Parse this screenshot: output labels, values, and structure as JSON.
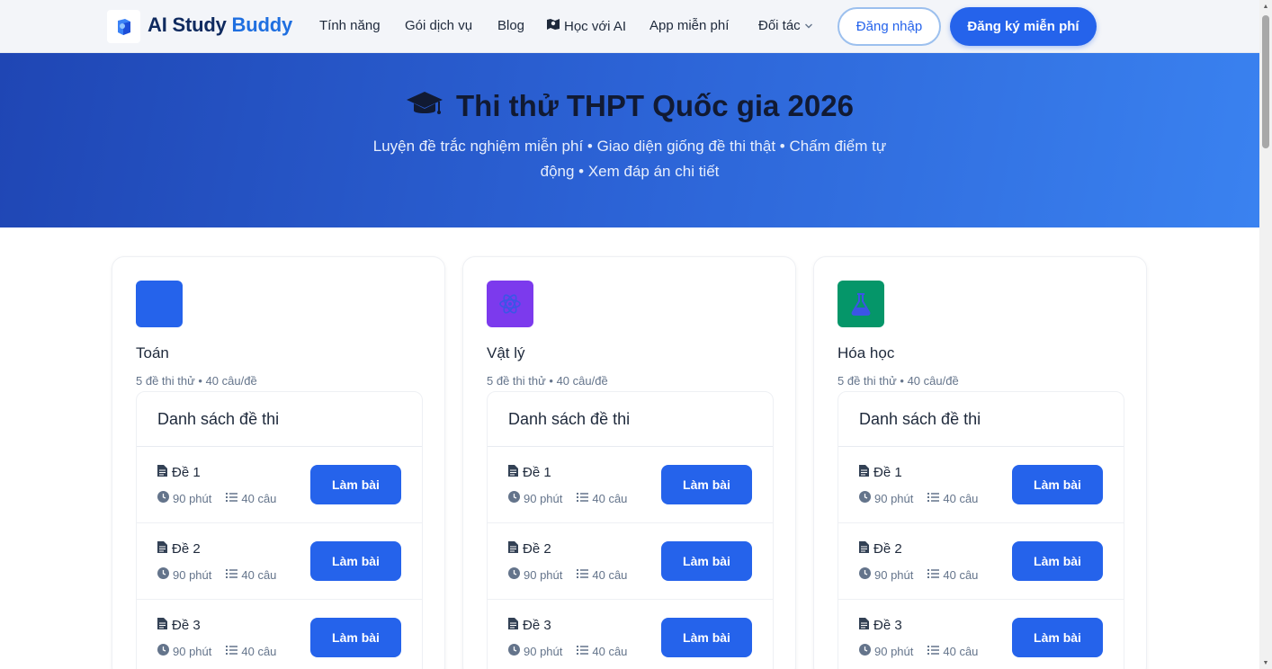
{
  "nav": {
    "logo": {
      "part1": "AI Study",
      "part2": "Buddy"
    },
    "links": [
      {
        "label": "Tính năng"
      },
      {
        "label": "Gói dịch vụ"
      },
      {
        "label": "Blog"
      },
      {
        "label": "Học với AI",
        "icon": "map-icon"
      },
      {
        "label": "App miễn phí"
      },
      {
        "label": "Đối tác",
        "icon": "chevron-down-icon"
      }
    ],
    "login_label": "Đăng nhập",
    "signup_label": "Đăng ký miễn phí"
  },
  "hero": {
    "icon": "graduation-cap-icon",
    "title": "Thi thử THPT Quốc gia 2026",
    "subtitle": "Luyện đề trắc nghiệm miễn phí • Giao diện giống đề thi thật • Chấm điểm tự động • Xem đáp án chi tiết"
  },
  "subjects": [
    {
      "name": "Toán",
      "meta": "5 đề thi thử • 40 câu/đề",
      "icon_color": "#2563eb",
      "list_title": "Danh sách đề thi",
      "exams": [
        {
          "title": "Đề 1",
          "duration": "90 phút",
          "questions": "40 câu",
          "action": "Làm bài"
        },
        {
          "title": "Đề 2",
          "duration": "90 phút",
          "questions": "40 câu",
          "action": "Làm bài"
        },
        {
          "title": "Đề 3",
          "duration": "90 phút",
          "questions": "40 câu",
          "action": "Làm bài"
        }
      ]
    },
    {
      "name": "Vật lý",
      "meta": "5 đề thi thử • 40 câu/đề",
      "icon_color": "#7c3aed",
      "icon": "atom-icon",
      "list_title": "Danh sách đề thi",
      "exams": [
        {
          "title": "Đề 1",
          "duration": "90 phút",
          "questions": "40 câu",
          "action": "Làm bài"
        },
        {
          "title": "Đề 2",
          "duration": "90 phút",
          "questions": "40 câu",
          "action": "Làm bài"
        },
        {
          "title": "Đề 3",
          "duration": "90 phút",
          "questions": "40 câu",
          "action": "Làm bài"
        }
      ]
    },
    {
      "name": "Hóa học",
      "meta": "5 đề thi thử • 40 câu/đề",
      "icon_color": "#059669",
      "icon": "flask-icon",
      "list_title": "Danh sách đề thi",
      "exams": [
        {
          "title": "Đề 1",
          "duration": "90 phút",
          "questions": "40 câu",
          "action": "Làm bài"
        },
        {
          "title": "Đề 2",
          "duration": "90 phút",
          "questions": "40 câu",
          "action": "Làm bài"
        },
        {
          "title": "Đề 3",
          "duration": "90 phút",
          "questions": "40 câu",
          "action": "Làm bài"
        }
      ]
    }
  ]
}
